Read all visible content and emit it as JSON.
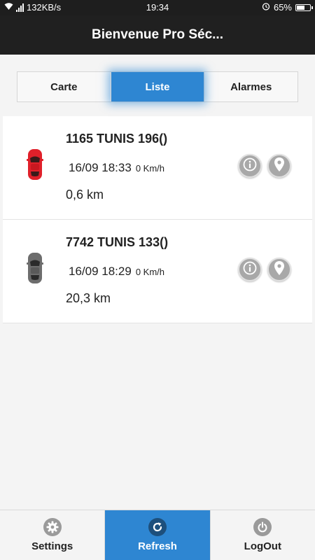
{
  "status_bar": {
    "network": "132KB/s",
    "time": "19:34",
    "battery": "65%",
    "battery_level": 0.65
  },
  "header": {
    "title": "Bienvenue Pro Séc..."
  },
  "tabs": [
    {
      "label": "Carte",
      "active": false
    },
    {
      "label": "Liste",
      "active": true
    },
    {
      "label": "Alarmes",
      "active": false
    }
  ],
  "vehicles": [
    {
      "name": "1165 TUNIS 196()",
      "datetime": "16/09 18:33",
      "speed": "0 Km/h",
      "distance": "0,6 km",
      "car_color": "#e0202a",
      "icon": "red-car-icon"
    },
    {
      "name": "7742 TUNIS 133()",
      "datetime": "16/09 18:29",
      "speed": "0 Km/h",
      "distance": "20,3 km",
      "car_color": "#6d6d6d",
      "icon": "gray-car-icon"
    }
  ],
  "bottom_bar": {
    "settings": "Settings",
    "refresh": "Refresh",
    "logout": "LogOut"
  },
  "colors": {
    "accent": "#2e86d2",
    "header_bg": "#202020"
  }
}
